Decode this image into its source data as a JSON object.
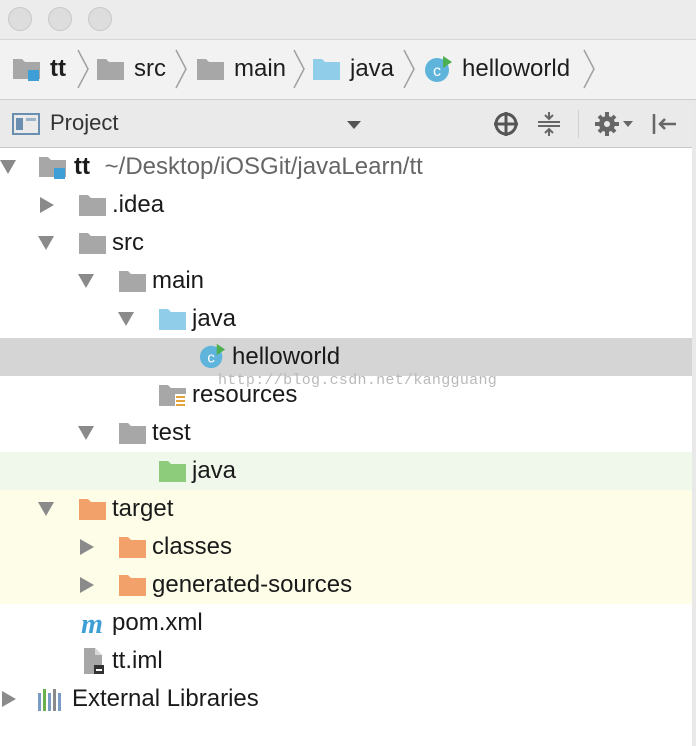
{
  "breadcrumb": {
    "items": [
      {
        "label": "tt",
        "icon": "module-folder-icon"
      },
      {
        "label": "src",
        "icon": "folder-icon"
      },
      {
        "label": "main",
        "icon": "folder-icon"
      },
      {
        "label": "java",
        "icon": "source-folder-icon"
      },
      {
        "label": "helloworld",
        "icon": "java-class-icon"
      }
    ]
  },
  "toolbar": {
    "title": "Project",
    "icons": [
      "view-dropdown-icon",
      "locate-icon",
      "collapse-all-icon",
      "settings-icon",
      "hide-icon"
    ]
  },
  "tree": {
    "root_name": "tt",
    "root_path": "~/Desktop/iOSGit/javaLearn/tt",
    "idea": ".idea",
    "src": "src",
    "main": "main",
    "java": "java",
    "helloworld": "helloworld",
    "resources": "resources",
    "test": "test",
    "test_java": "java",
    "target": "target",
    "classes": "classes",
    "generated_sources": "generated-sources",
    "pom": "pom.xml",
    "iml": "tt.iml",
    "external_libraries": "External Libraries"
  },
  "watermark": "http://blog.csdn.net/kangguang",
  "colors": {
    "selection": "#d5d5d5",
    "test_background": "#eff8ea",
    "excluded_background": "#fdfde8",
    "folder_gray": "#a7a7a7",
    "source_folder_blue": "#8fcde9",
    "test_folder_green": "#8dcc7a",
    "excluded_folder_orange": "#f2a16a",
    "class_icon_blue": "#5fb4db"
  }
}
